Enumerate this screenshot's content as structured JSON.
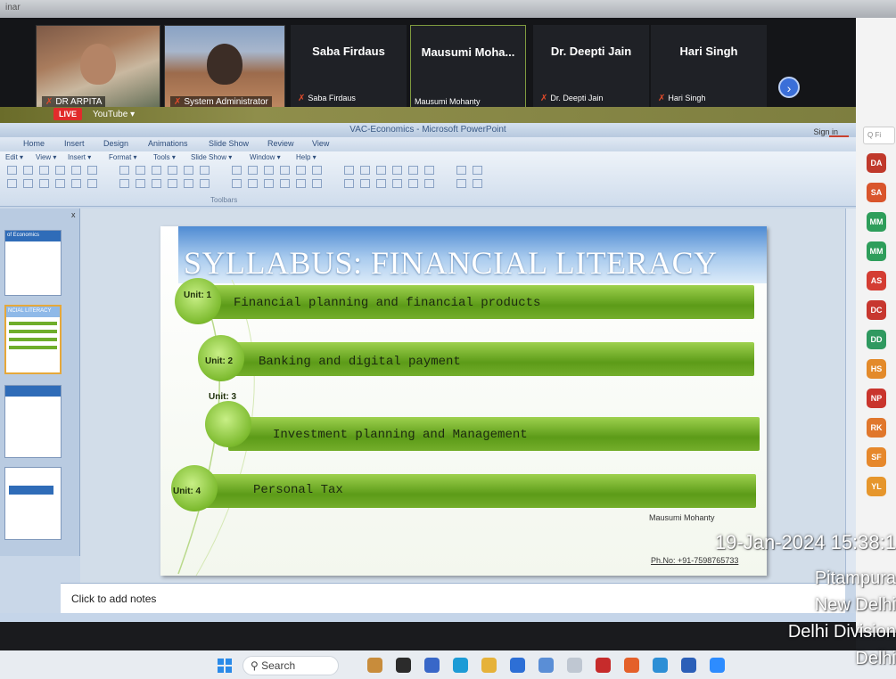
{
  "top_strip": {
    "label": "inar"
  },
  "meeting": {
    "tiles": [
      {
        "name": "DR ARPITA"
      },
      {
        "name": "System Administrator"
      }
    ],
    "name_tiles": [
      {
        "display": "Saba Firdaus",
        "label": "Saba Firdaus"
      },
      {
        "display": "Mausumi  Moha...",
        "label": "Mausumi Mohanty"
      },
      {
        "display": "Dr. Deepti Jain",
        "label": "Dr. Deepti Jain"
      },
      {
        "display": "Hari Singh",
        "label": "Hari Singh"
      }
    ],
    "next_icon": "chevron-right-icon",
    "live_label": "LIVE",
    "youtube_label": "YouTube ▾"
  },
  "right_panel": {
    "search_placeholder": "Q Fi",
    "avatars": [
      {
        "initials": "DA",
        "color": "#c0392b"
      },
      {
        "initials": "SA",
        "color": "#d9552c"
      },
      {
        "initials": "MM",
        "color": "#2e9e5b"
      },
      {
        "initials": "MM",
        "color": "#2e9e5b"
      },
      {
        "initials": "AS",
        "color": "#d43d33"
      },
      {
        "initials": "DC",
        "color": "#c7372f"
      },
      {
        "initials": "DD",
        "color": "#2f9960"
      },
      {
        "initials": "HS",
        "color": "#e38a2a"
      },
      {
        "initials": "NP",
        "color": "#c9352d"
      },
      {
        "initials": "RK",
        "color": "#e0772c"
      },
      {
        "initials": "SF",
        "color": "#e6882c"
      },
      {
        "initials": "YL",
        "color": "#e6962c"
      }
    ]
  },
  "powerpoint": {
    "window_title": "VAC-Economics - Microsoft PowerPoint",
    "sign_in": "Sign in",
    "tabs": [
      "Home",
      "Insert",
      "Design",
      "Animations",
      "Slide Show",
      "Review",
      "View"
    ],
    "menu": [
      "Edit ▾",
      "View ▾",
      "Insert ▾",
      "Format ▾",
      "Tools ▾",
      "Slide Show ▾",
      "Window ▾",
      "Help ▾"
    ],
    "toolbars_label": "Toolbars",
    "thumbnails": [
      {
        "title": "of Economics"
      },
      {
        "title": "NCIAL LITERACY"
      },
      {
        "title": ""
      },
      {
        "title": ""
      }
    ],
    "slide": {
      "title": "SYLLABUS: FINANCIAL LITERACY",
      "units": [
        {
          "label": "Unit: 1",
          "text": "Financial planning and financial products"
        },
        {
          "label": "Unit: 2",
          "text": "Banking and digital payment"
        },
        {
          "label": "Unit: 3",
          "text": "Investment planning and Management"
        },
        {
          "label": "Unit: 4",
          "text": "Personal Tax"
        }
      ],
      "presenter": "Mausumi Mohanty",
      "phone": "Ph.No: +91-7598765733"
    },
    "notes_placeholder": "Click to add notes"
  },
  "taskbar": {
    "search_label": "Search",
    "apps": [
      {
        "icon": "people-icon",
        "color": "#c88c3b"
      },
      {
        "icon": "file-explorer-icon",
        "color": "#2b2b2b"
      },
      {
        "icon": "chat-icon",
        "color": "#3867c8"
      },
      {
        "icon": "edge-icon",
        "color": "#1c9bd6"
      },
      {
        "icon": "folder-icon",
        "color": "#e6b23a"
      },
      {
        "icon": "store-icon",
        "color": "#2d6fd6"
      },
      {
        "icon": "network-icon",
        "color": "#5a8ed6"
      },
      {
        "icon": "document-icon",
        "color": "#bfc7d2"
      },
      {
        "icon": "mcafee-icon",
        "color": "#c62b2b"
      },
      {
        "icon": "firefox-icon",
        "color": "#e4602a"
      },
      {
        "icon": "shield-icon",
        "color": "#2d8fd6"
      },
      {
        "icon": "word-icon",
        "color": "#2b5fb8"
      },
      {
        "icon": "zoom-icon",
        "color": "#2d8cff"
      }
    ]
  },
  "overlay": {
    "datetime": "19-Jan-2024 15:38:1",
    "line1": "Pitampura",
    "line2": "New Delhi",
    "line3": "Delhi Division",
    "line4": "Delhi"
  }
}
